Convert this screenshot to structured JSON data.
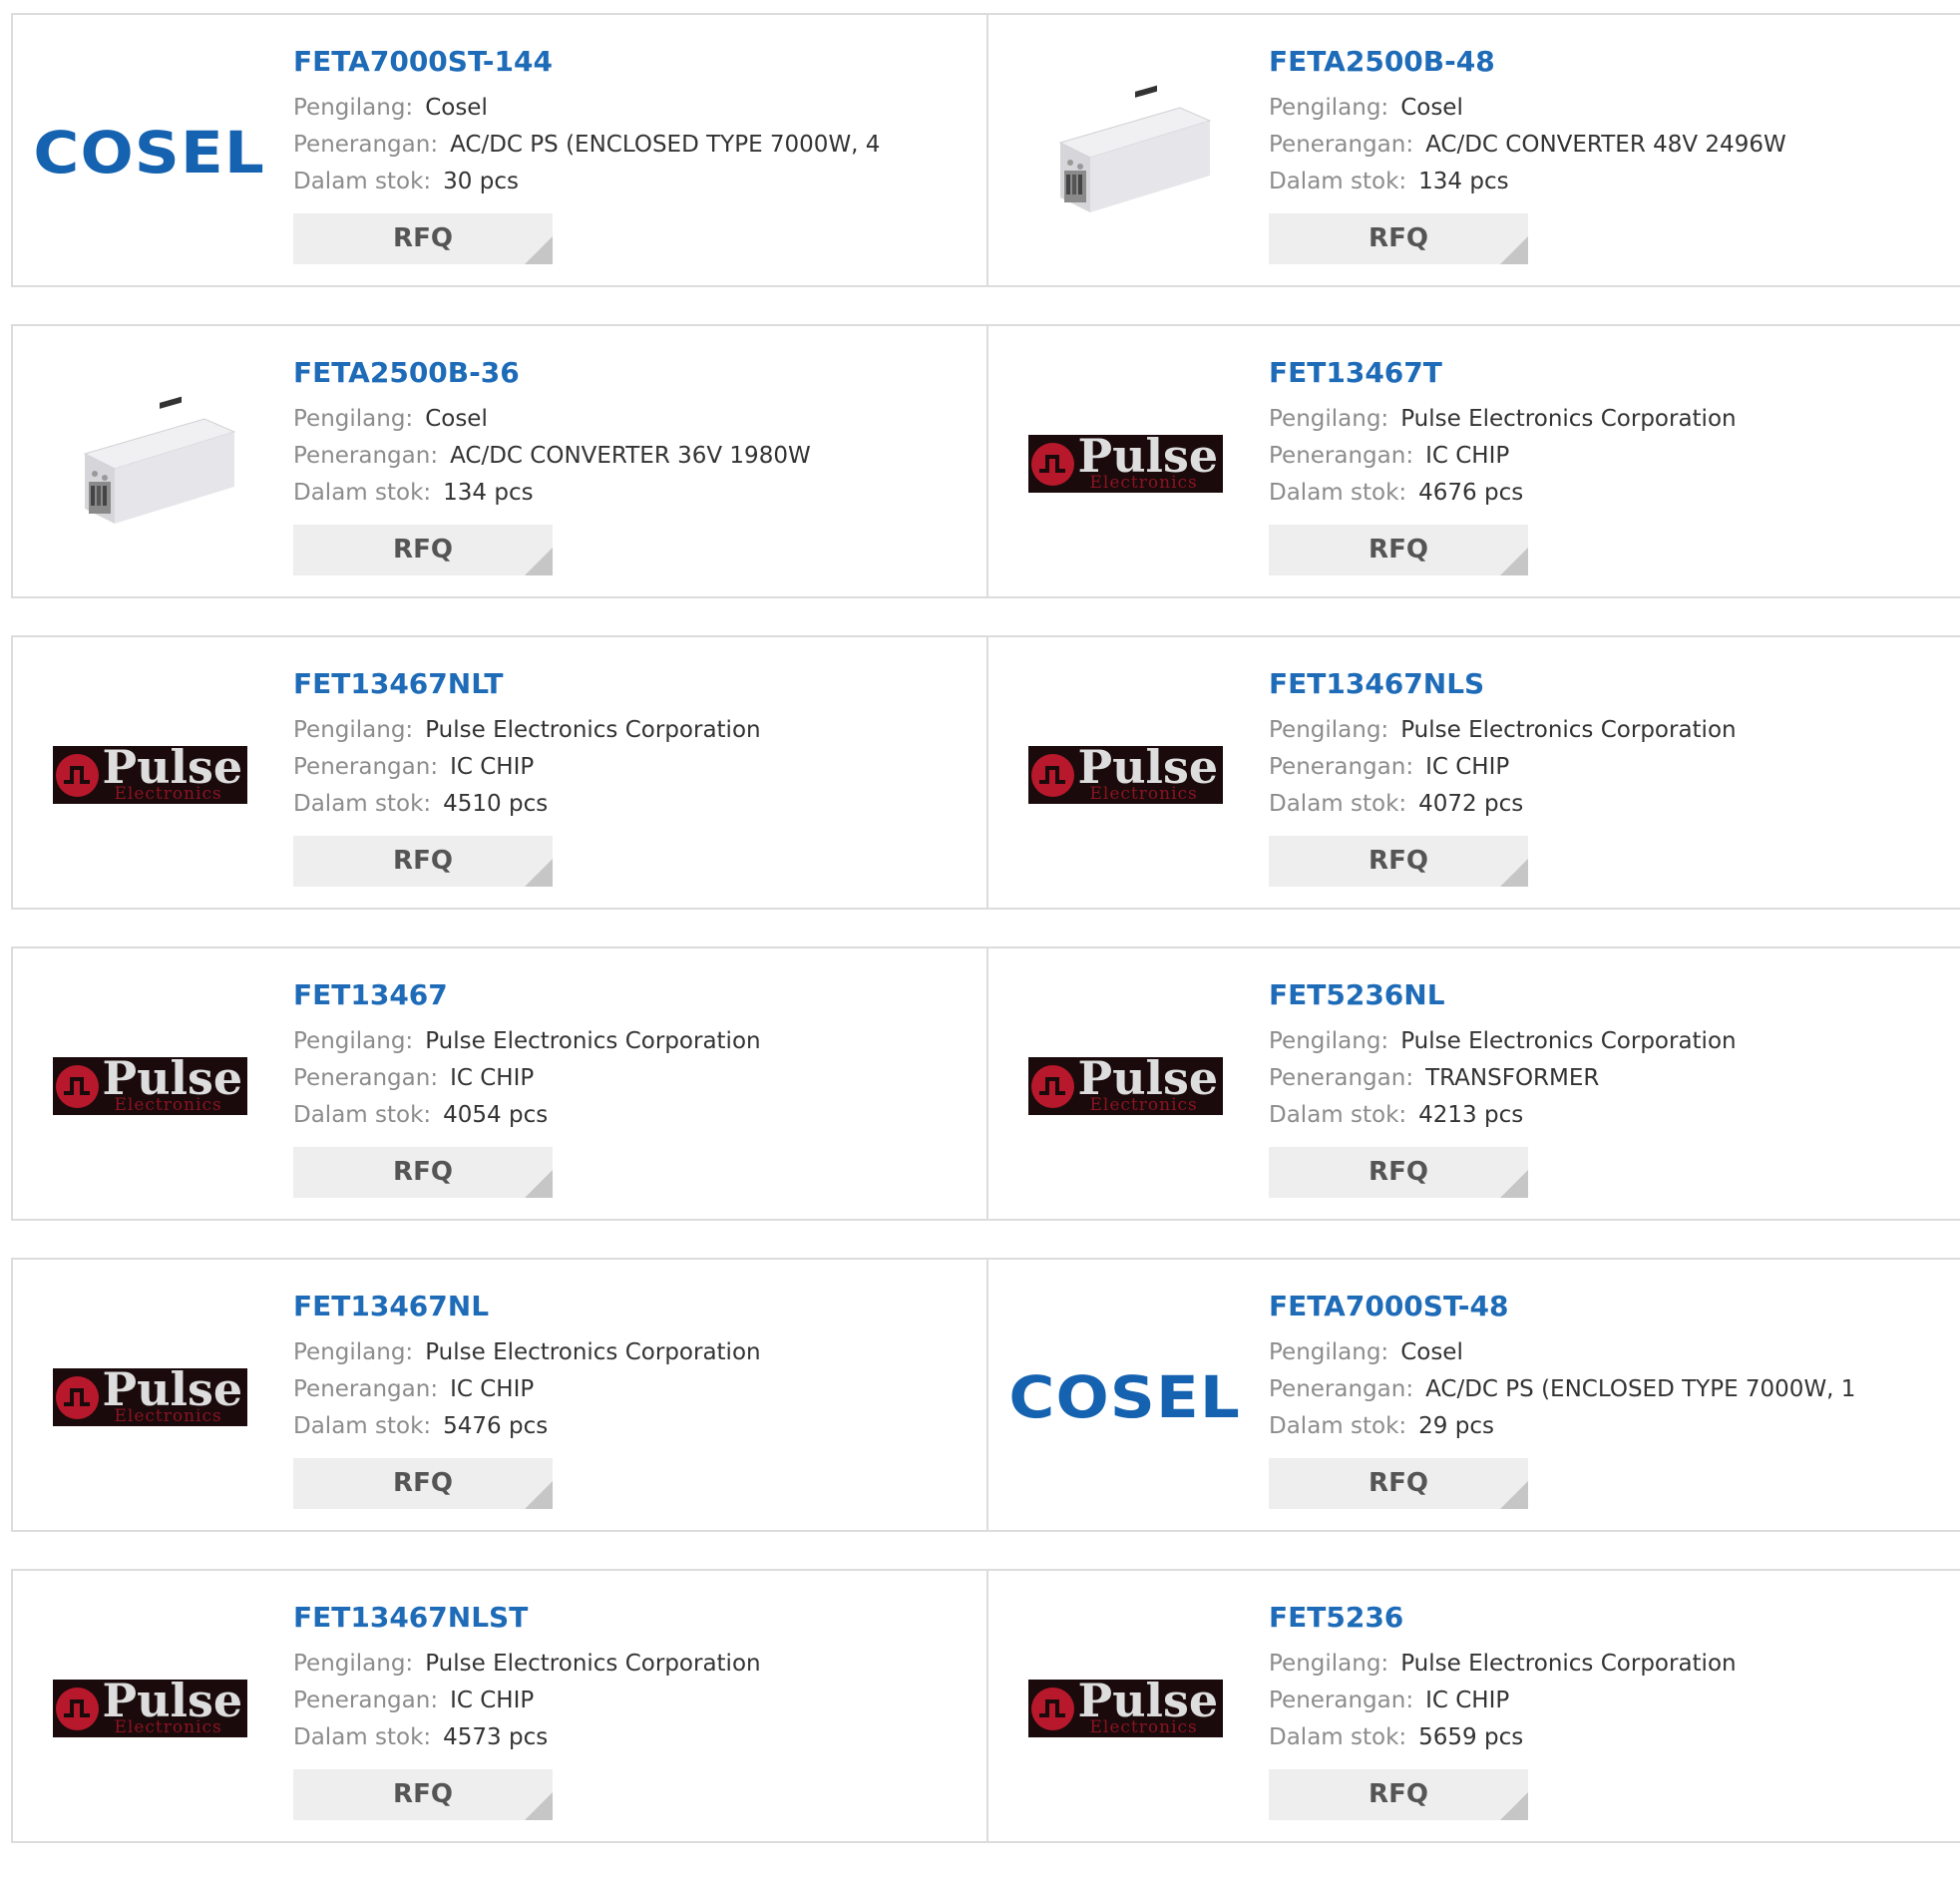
{
  "labels": {
    "manufacturer": "Pengilang:",
    "description": "Penerangan:",
    "stock": "Dalam stok:",
    "rfq": "RFQ"
  },
  "colors": {
    "title": "#1e6bb8",
    "label": "#8c8c8c",
    "value": "#333333",
    "button_bg": "#eeeeee",
    "cosel_blue": "#1462b0",
    "pulse_red": "#b8182b"
  },
  "logos": {
    "cosel": "COSEL",
    "pulse": "Pulse",
    "pulse_sub": "Electronics"
  },
  "products": [
    {
      "title": "FETA7000ST-144",
      "manufacturer": "Cosel",
      "description": "AC/DC PS (ENCLOSED TYPE 7000W, 4",
      "stock": "30 pcs",
      "image": "cosel-logo"
    },
    {
      "title": "FETA2500B-48",
      "manufacturer": "Cosel",
      "description": "AC/DC CONVERTER 48V 2496W",
      "stock": "134 pcs",
      "image": "power-supply-photo"
    },
    {
      "title": "FETA2500B-36",
      "manufacturer": "Cosel",
      "description": "AC/DC CONVERTER 36V 1980W",
      "stock": "134 pcs",
      "image": "power-supply-photo"
    },
    {
      "title": "FET13467T",
      "manufacturer": "Pulse Electronics Corporation",
      "description": "IC CHIP",
      "stock": "4676 pcs",
      "image": "pulse-logo"
    },
    {
      "title": "FET13467NLT",
      "manufacturer": "Pulse Electronics Corporation",
      "description": "IC CHIP",
      "stock": "4510 pcs",
      "image": "pulse-logo"
    },
    {
      "title": "FET13467NLS",
      "manufacturer": "Pulse Electronics Corporation",
      "description": "IC CHIP",
      "stock": "4072 pcs",
      "image": "pulse-logo"
    },
    {
      "title": "FET13467",
      "manufacturer": "Pulse Electronics Corporation",
      "description": "IC CHIP",
      "stock": "4054 pcs",
      "image": "pulse-logo"
    },
    {
      "title": "FET5236NL",
      "manufacturer": "Pulse Electronics Corporation",
      "description": "TRANSFORMER",
      "stock": "4213 pcs",
      "image": "pulse-logo"
    },
    {
      "title": "FET13467NL",
      "manufacturer": "Pulse Electronics Corporation",
      "description": "IC CHIP",
      "stock": "5476 pcs",
      "image": "pulse-logo"
    },
    {
      "title": "FETA7000ST-48",
      "manufacturer": "Cosel",
      "description": "AC/DC PS (ENCLOSED TYPE 7000W, 1",
      "stock": "29 pcs",
      "image": "cosel-logo"
    },
    {
      "title": "FET13467NLST",
      "manufacturer": "Pulse Electronics Corporation",
      "description": "IC CHIP",
      "stock": "4573 pcs",
      "image": "pulse-logo"
    },
    {
      "title": "FET5236",
      "manufacturer": "Pulse Electronics Corporation",
      "description": "IC CHIP",
      "stock": "5659 pcs",
      "image": "pulse-logo"
    }
  ]
}
